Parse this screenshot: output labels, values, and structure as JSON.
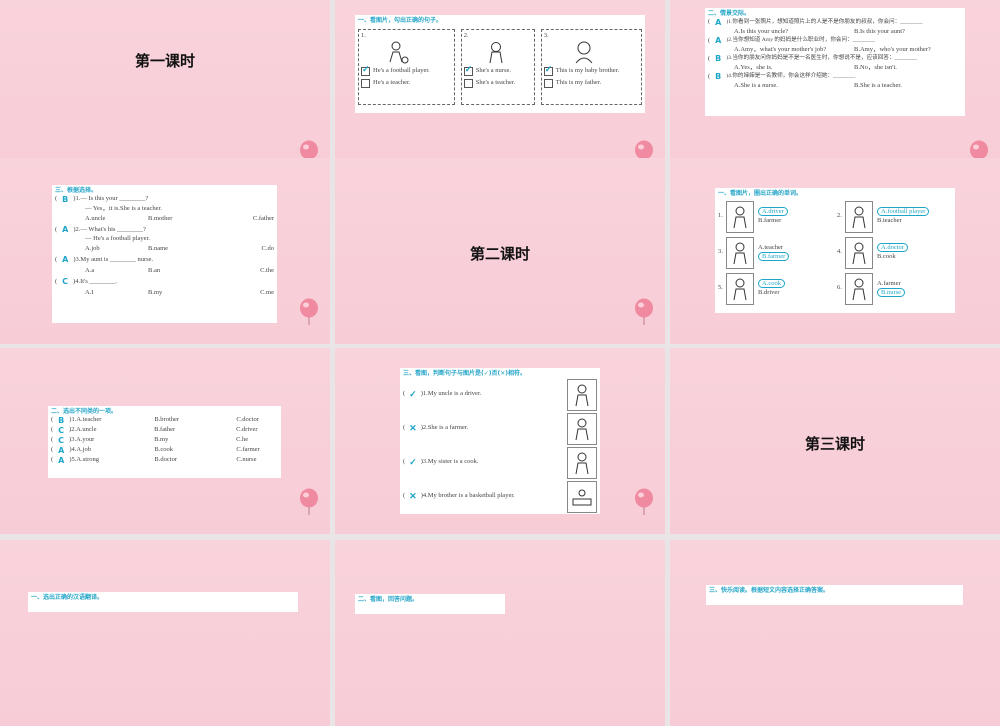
{
  "slides": {
    "s1": {
      "title": "第一课时"
    },
    "s2": {
      "heading": "一、看图片，勾出正确的句子。",
      "frames": [
        {
          "num": "1.",
          "opt1": "He's a football player.",
          "opt2": "He's a teacher.",
          "checked": 1
        },
        {
          "num": "2.",
          "opt1": "She's a nurse.",
          "opt2": "She's a teacher.",
          "checked": 1
        },
        {
          "num": "3.",
          "opt1": "This is my baby brother.",
          "opt2": "This is my father.",
          "checked": 1
        }
      ]
    },
    "s3": {
      "heading": "二、情景交际。",
      "items": [
        {
          "ans": "A",
          "q": ")1.你看到一张照片，想知道照片上的人是不是你朋友的叔叔，你会问：________",
          "a": "A.Is this your uncle?",
          "b": "B.Is this your aunt?"
        },
        {
          "ans": "A",
          "q": ")2.当你想知道 Amy 的妈妈是什么职业时，你会问：________",
          "a": "A.Amy，what's your mother's job?",
          "b": "B.Amy，who's your mother?"
        },
        {
          "ans": "B",
          "q": ")3.当你的朋友问你妈妈是不是一名医生时，你想说不是，应该回答：________",
          "a": "A.Yes，she is.",
          "b": "B.No，she isn't."
        },
        {
          "ans": "B",
          "q": ")4.你的婶婶是一名教师，你会这样介绍她：________",
          "a": "A.She is a nurse.",
          "b": "B.She is a teacher."
        }
      ]
    },
    "s4": {
      "heading": "三、根据选择。",
      "items": [
        {
          "ans": "B",
          "q": ")1.— Is this your ________?",
          "q2": "— Yes，it is.She is a teacher.",
          "a": "A.uncle",
          "b": "B.mother",
          "c": "C.father"
        },
        {
          "ans": "A",
          "q": ")2.— What's his ________?",
          "q2": "— He's a football player.",
          "a": "A.job",
          "b": "B.name",
          "c": "C.do"
        },
        {
          "ans": "A",
          "q": ")3.My aunt is ________ nurse.",
          "q2": "",
          "a": "A.a",
          "b": "B.an",
          "c": "C.the"
        },
        {
          "ans": "C",
          "q": ")4.It's ________.",
          "q2": "",
          "a": "A.I",
          "b": "B.my",
          "c": "C.me"
        }
      ]
    },
    "s5": {
      "title": "第二课时"
    },
    "s6": {
      "heading": "一、看图片，圈出正确的单词。",
      "items": [
        {
          "num": "1.",
          "a": "A.driver",
          "b": "B.farmer",
          "circled": "a"
        },
        {
          "num": "2.",
          "a": "A.football player",
          "b": "B.teacher",
          "circled": "a"
        },
        {
          "num": "3.",
          "a": "A.teacher",
          "b": "B.farmer",
          "circled": "b"
        },
        {
          "num": "4.",
          "a": "A.doctor",
          "b": "B.cook",
          "circled": "a"
        },
        {
          "num": "5.",
          "a": "A.cook",
          "b": "B.driver",
          "circled": "a"
        },
        {
          "num": "6.",
          "a": "A.farmer",
          "b": "B.nurse",
          "circled": "b"
        }
      ]
    },
    "s7": {
      "heading": "二、选出不同类的一项。",
      "items": [
        {
          "ans": "B",
          "num": ")1.",
          "a": "A.teacher",
          "b": "B.brother",
          "c": "C.doctor"
        },
        {
          "ans": "C",
          "num": ")2.",
          "a": "A.uncle",
          "b": "B.father",
          "c": "C.driver"
        },
        {
          "ans": "C",
          "num": ")3.",
          "a": "A.your",
          "b": "B.my",
          "c": "C.he"
        },
        {
          "ans": "A",
          "num": ")4.",
          "a": "A.job",
          "b": "B.cook",
          "c": "C.farmer"
        },
        {
          "ans": "A",
          "num": ")5.",
          "a": "A.strong",
          "b": "B.doctor",
          "c": "C.nurse"
        }
      ]
    },
    "s8": {
      "heading": "三、看图，判断句子与图片是(✓)否(✕)相符。",
      "items": [
        {
          "mark": "✓",
          "text": ")1.My uncle is a driver."
        },
        {
          "mark": "✕",
          "text": ")2.She is a farmer."
        },
        {
          "mark": "✓",
          "text": ")3.My sister is a cook."
        },
        {
          "mark": "✕",
          "text": ")4.My brother is a basketball player."
        }
      ]
    },
    "s9": {
      "title": "第三课时"
    },
    "s10": {
      "heading": "一、选出正确的汉语翻译。"
    },
    "s11": {
      "heading": "二、看图，回答问题。"
    },
    "s12": {
      "heading": "三、快乐阅读。根据短文内容选择正确答案。"
    }
  }
}
